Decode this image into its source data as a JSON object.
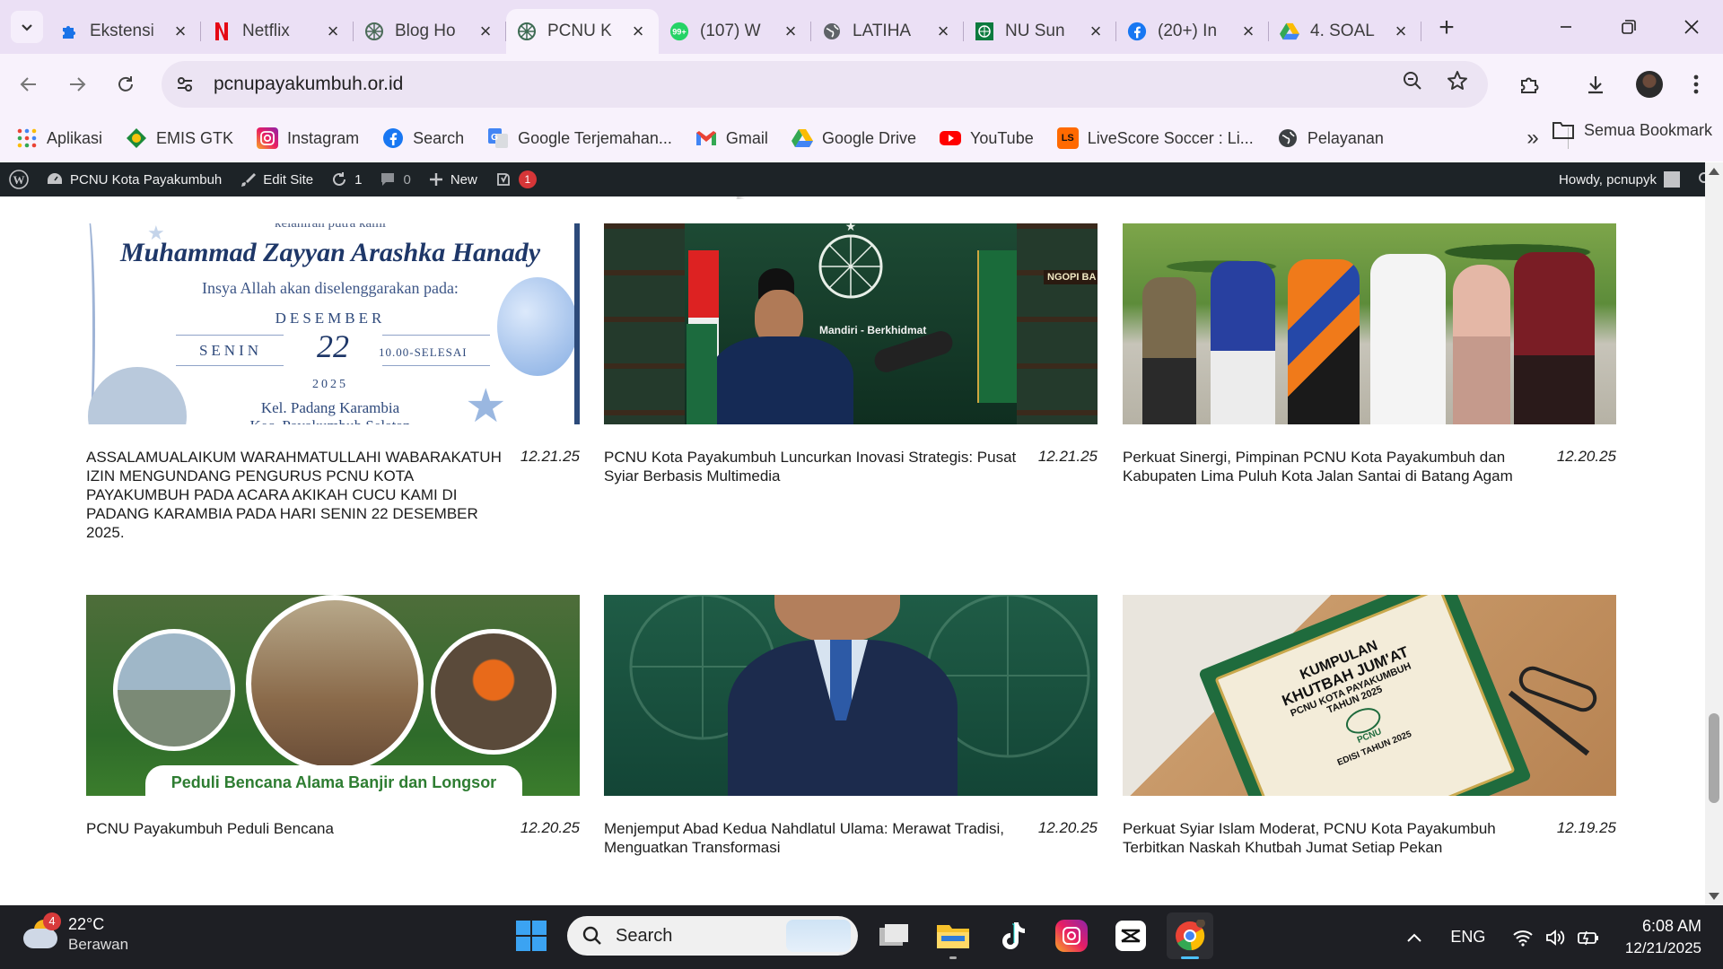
{
  "browser": {
    "tabs": [
      {
        "title": "Ekstensi",
        "icon": "puzzle-icon"
      },
      {
        "title": "Netflix",
        "icon": "netflix-icon"
      },
      {
        "title": "Blog Ho",
        "icon": "blog-icon"
      },
      {
        "title": "PCNU K",
        "icon": "pcnu-icon",
        "active": true
      },
      {
        "title": "(107) W",
        "icon": "whatsapp-icon",
        "badge": "99+"
      },
      {
        "title": "LATIHA",
        "icon": "globe-icon"
      },
      {
        "title": "NU Sun",
        "icon": "nu-icon"
      },
      {
        "title": "(20+) In",
        "icon": "facebook-icon"
      },
      {
        "title": "4. SOAL",
        "icon": "google-drive-icon"
      }
    ],
    "url": "pcnupayakumbuh.or.id",
    "bookmarks": [
      {
        "label": "Aplikasi",
        "icon": "apps-grid-icon"
      },
      {
        "label": "EMIS GTK",
        "icon": "emis-icon"
      },
      {
        "label": "Instagram",
        "icon": "instagram-icon"
      },
      {
        "label": "Search",
        "icon": "facebook-icon"
      },
      {
        "label": "Google Terjemahan...",
        "icon": "translate-icon"
      },
      {
        "label": "Gmail",
        "icon": "gmail-icon"
      },
      {
        "label": "Google Drive",
        "icon": "google-drive-icon"
      },
      {
        "label": "YouTube",
        "icon": "youtube-icon"
      },
      {
        "label": "LiveScore Soccer : Li...",
        "icon": "livescore-icon"
      },
      {
        "label": "Pelayanan",
        "icon": "globe-icon"
      }
    ],
    "all_bookmarks": "Semua Bookmark"
  },
  "wpbar": {
    "site": "PCNU Kota Payakumbuh",
    "edit": "Edit Site",
    "updates": "1",
    "comments": "0",
    "new": "New",
    "notif": "1",
    "howdy": "Howdy, pcnupyk"
  },
  "posts": [
    {
      "title": "ASSALAMUALAIKUM WARAHMATULLAHI WABARAKATUH IZIN MENGUNDANG PENGURUS PCNU KOTA PAYAKUMBUH PADA ACARA AKIKAH CUCU KAMI DI PADANG KARAMBIA PADA HARI SENIN 22 DESEMBER 2025.",
      "date": "12.21.25",
      "invite": {
        "top": "kelahiran putra kami",
        "name": "Muhammad Zayyan Arashka Hanady",
        "sub": "Insya Allah akan diselenggarakan pada:",
        "month": "DESEMBER",
        "day": "SENIN",
        "date": "22",
        "time": "10.00-SELESAI",
        "year": "2025",
        "place": "Kel. Padang Karambia",
        "place2": "Kec. Payakumbuh Selatan"
      }
    },
    {
      "title": "PCNU Kota Payakumbuh Luncurkan Inovasi Strategis: Pusat Syiar Berbasis Multimedia",
      "date": "12.21.25",
      "img_text": "Mandiri - Berkhidmat",
      "img_sign": "NGOPI BA"
    },
    {
      "title": "Perkuat Sinergi, Pimpinan PCNU Kota Payakumbuh dan Kabupaten Lima Puluh Kota Jalan Santai di Batang Agam",
      "date": "12.20.25"
    },
    {
      "title": "PCNU Payakumbuh Peduli Bencana",
      "date": "12.20.25",
      "banner": "Peduli Bencana Alama Banjir dan Longsor"
    },
    {
      "title": "Menjemput Abad Kedua Nahdlatul Ulama: Merawat Tradisi, Menguatkan Transformasi",
      "date": "12.20.25"
    },
    {
      "title": "Perkuat Syiar Islam Moderat, PCNU Kota Payakumbuh Terbitkan Naskah Khutbah Jumat Setiap Pekan",
      "date": "12.19.25",
      "book": {
        "l1": "KUMPULAN",
        "l2": "KHUTBAH JUM'AT",
        "l3": "PCNU KOTA PAYAKUMBUH",
        "l4": "TAHUN 2025",
        "l5": "PCNU",
        "l6": "EDISI TAHUN 2025"
      }
    }
  ],
  "taskbar": {
    "weather_badge": "4",
    "temp": "22°C",
    "condition": "Berawan",
    "search": "Search",
    "lang": "ENG",
    "time": "6:08 AM",
    "date": "12/21/2025"
  }
}
